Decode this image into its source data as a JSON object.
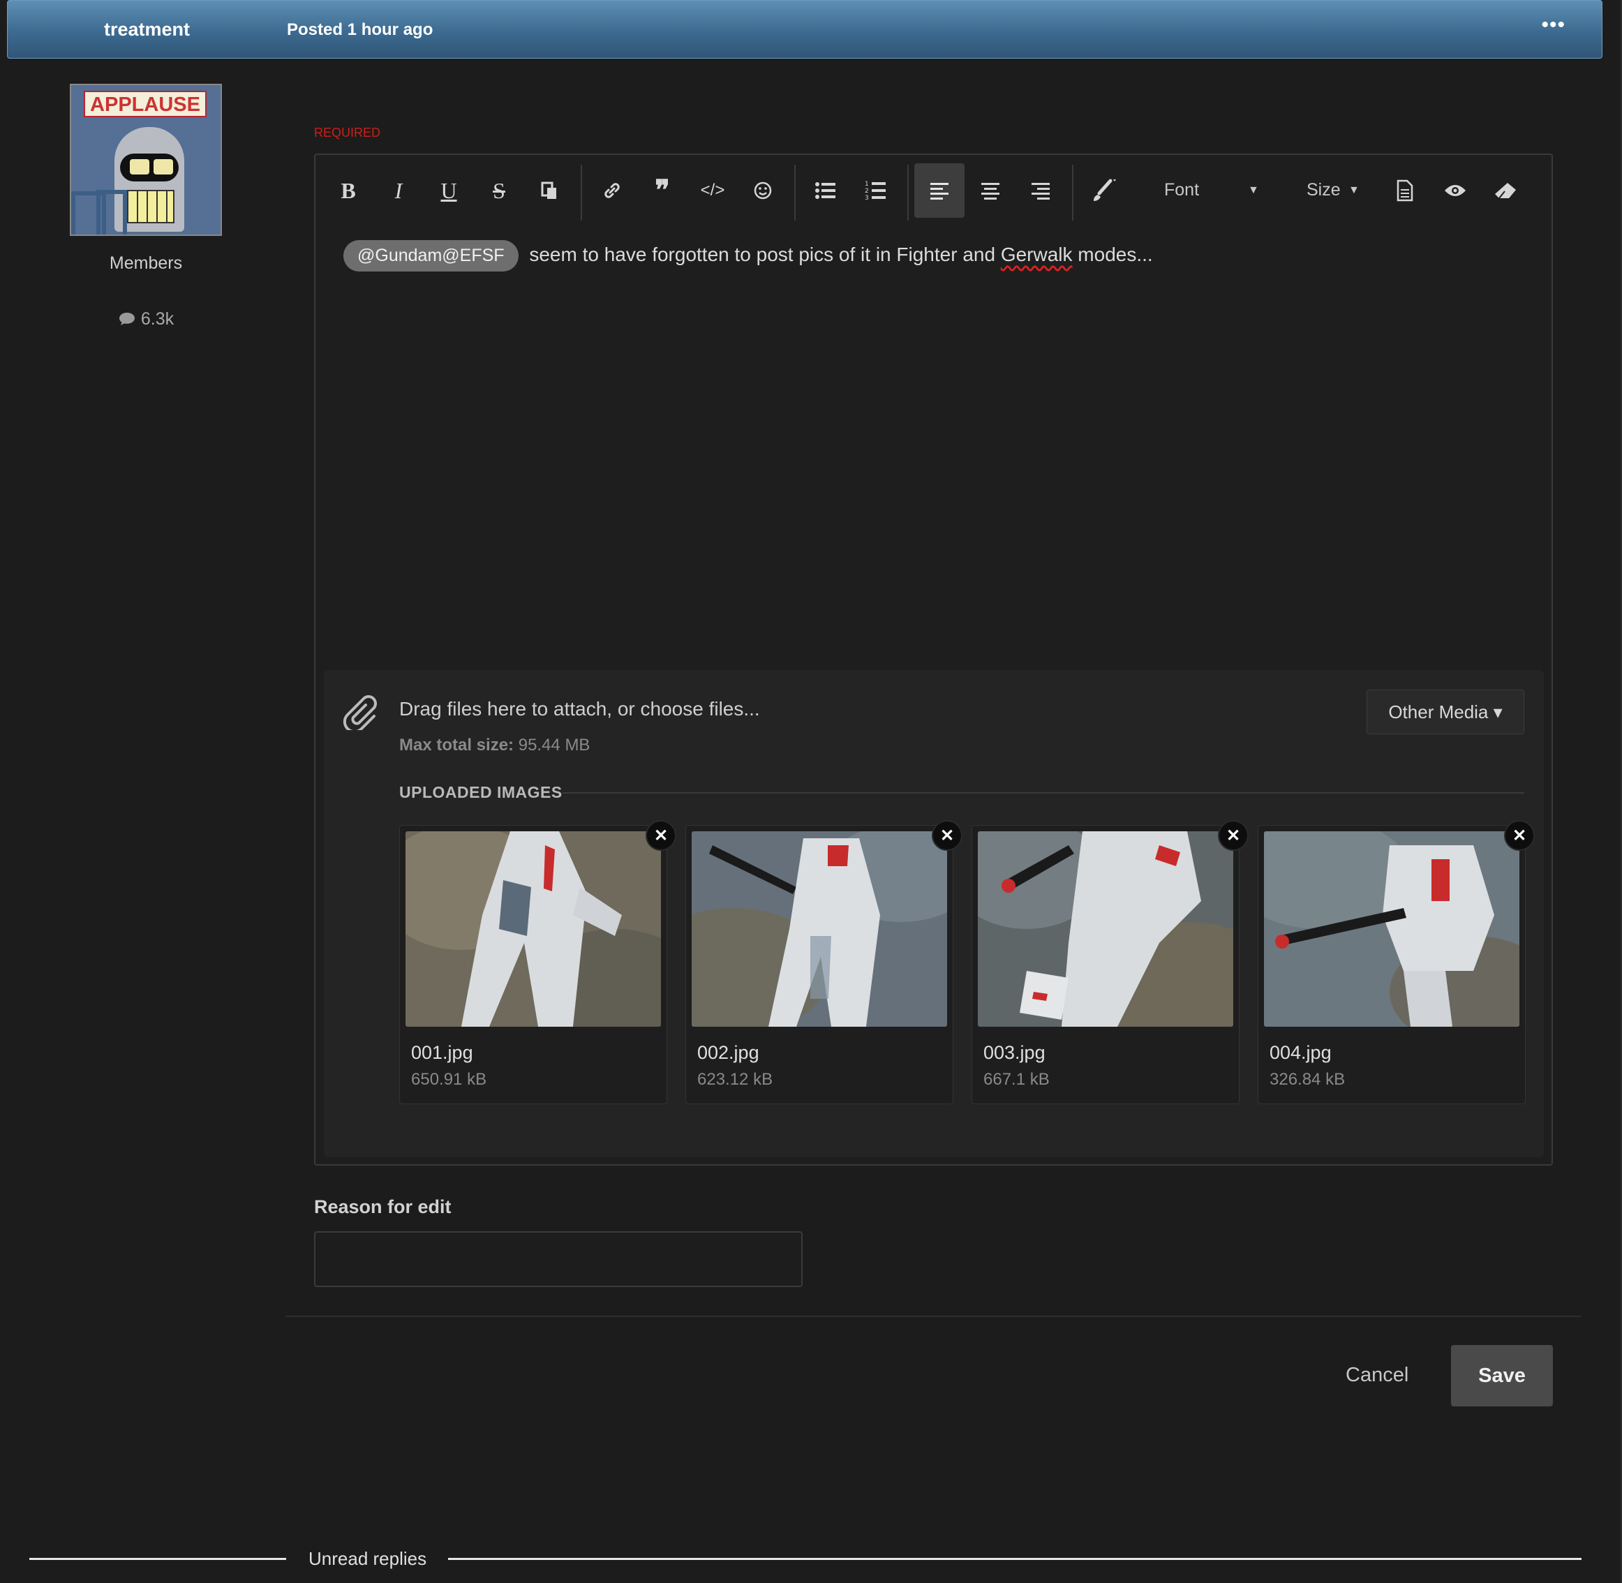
{
  "header": {
    "author": "treatment",
    "posted": "Posted 1 hour ago",
    "more_label": "•••"
  },
  "author_panel": {
    "avatar_sign_text": "APPLAUSE",
    "group": "Members",
    "post_count": "6.3k",
    "post_count_icon": "speech-bubble-icon"
  },
  "editor": {
    "required_label": "REQUIRED",
    "toolbar": {
      "bold": "B",
      "italic": "I",
      "underline": "U",
      "strike": "S",
      "font_label": "Font",
      "size_label": "Size"
    },
    "content": {
      "mention": "@Gundam@EFSF",
      "text_before": " seem to have forgotten to post pics of it in Fighter and ",
      "misspelled": "Gerwalk",
      "text_after": " modes..."
    },
    "attachments": {
      "drag_text": "Drag files here to attach, or choose files...",
      "max_label": "Max total size:",
      "max_value": " 95.44 MB",
      "other_media": "Other Media ▾",
      "uploaded_heading": "UPLOADED IMAGES",
      "files": [
        {
          "name": "001.jpg",
          "size": "650.91 kB"
        },
        {
          "name": "002.jpg",
          "size": "623.12 kB"
        },
        {
          "name": "003.jpg",
          "size": "667.1 kB"
        },
        {
          "name": "004.jpg",
          "size": "326.84 kB"
        }
      ],
      "remove_label": "✕"
    }
  },
  "reason": {
    "label": "Reason for edit",
    "value": ""
  },
  "actions": {
    "cancel": "Cancel",
    "save": "Save"
  },
  "footer": {
    "unread_replies": "Unread replies"
  }
}
